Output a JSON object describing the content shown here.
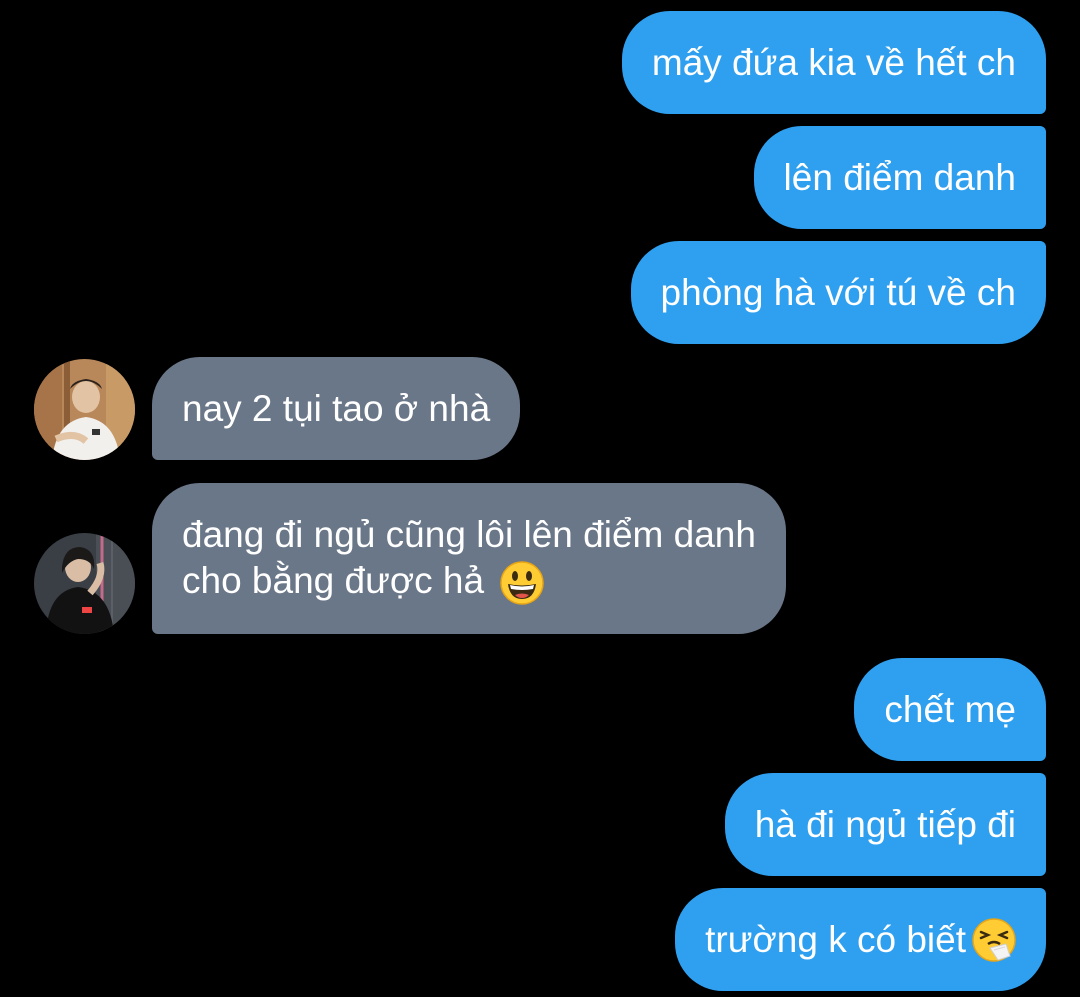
{
  "messages": {
    "m1": "mấy đứa kia về hết ch",
    "m2": "lên điểm danh",
    "m3": "phòng hà với tú về ch",
    "m4": "nay 2 tụi tao ở nhà",
    "m5_line1": "đang đi ngủ cũng lôi lên điểm danh",
    "m5_line2": "cho bằng được hả",
    "m6": "chết mẹ",
    "m7": "hà đi ngủ tiếp đi",
    "m8": "trường k có biết"
  },
  "icons": {
    "m5_emoji": "grinning-face-emoji",
    "m8_emoji": "sneezing-face-emoji"
  },
  "colors": {
    "background": "#000000",
    "outgoing_bubble": "#2fa0f0",
    "incoming_bubble": "#6a7788",
    "text": "#ffffff"
  }
}
